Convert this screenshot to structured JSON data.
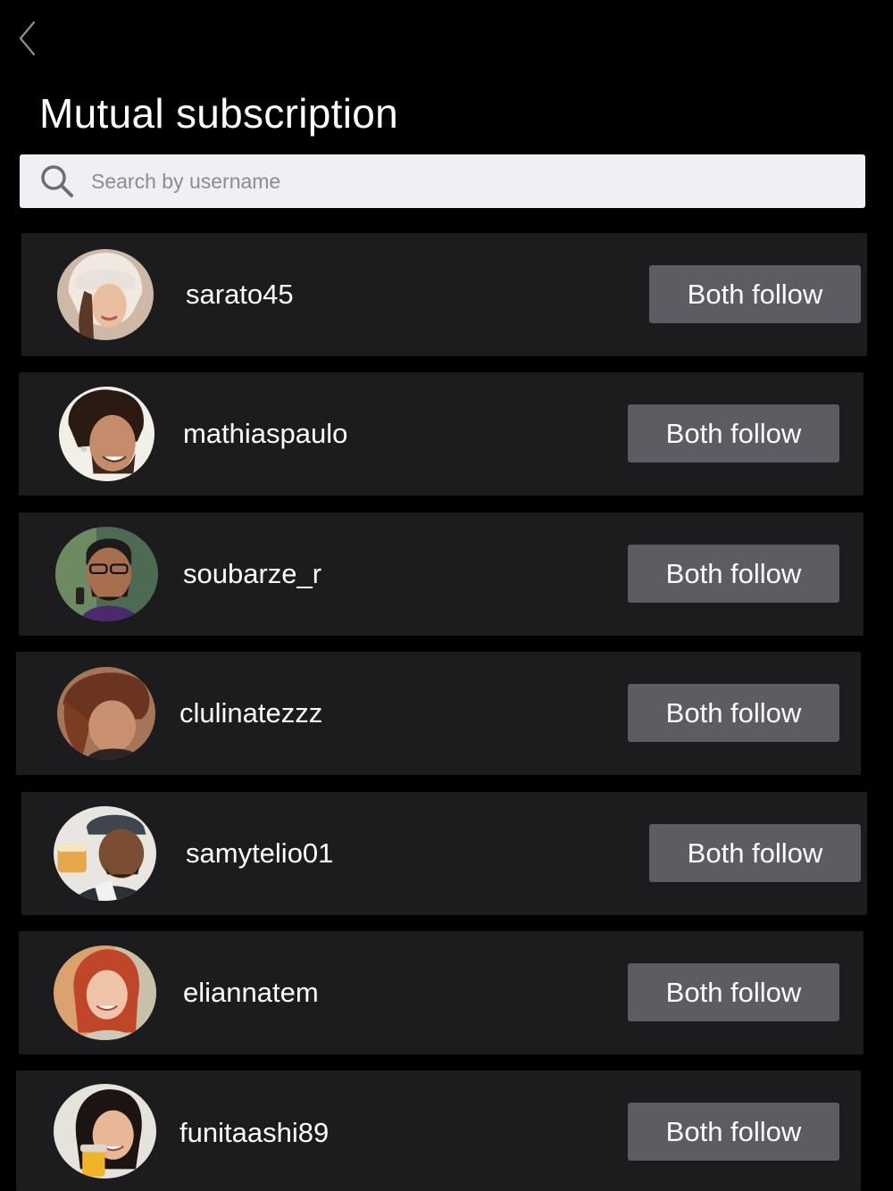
{
  "header": {
    "title": "Mutual subscription",
    "back_icon": "chevron-left-icon"
  },
  "search": {
    "placeholder": "Search by username",
    "value": "",
    "icon": "search-icon"
  },
  "colors": {
    "background": "#000000",
    "card": "#1c1c1e",
    "button": "#5c5d62",
    "search_bg": "#eff0f3",
    "text": "#ffffff",
    "placeholder": "#8a8d93"
  },
  "users": [
    {
      "username": "sarato45",
      "button_label": "Both follow"
    },
    {
      "username": "mathiaspaulo",
      "button_label": "Both follow"
    },
    {
      "username": "soubarze_r",
      "button_label": "Both follow"
    },
    {
      "username": "clulinatezzz",
      "button_label": "Both follow"
    },
    {
      "username": "samytelio01",
      "button_label": "Both follow"
    },
    {
      "username": "eliannatem",
      "button_label": "Both follow"
    },
    {
      "username": "funitaashi89",
      "button_label": "Both follow"
    }
  ]
}
